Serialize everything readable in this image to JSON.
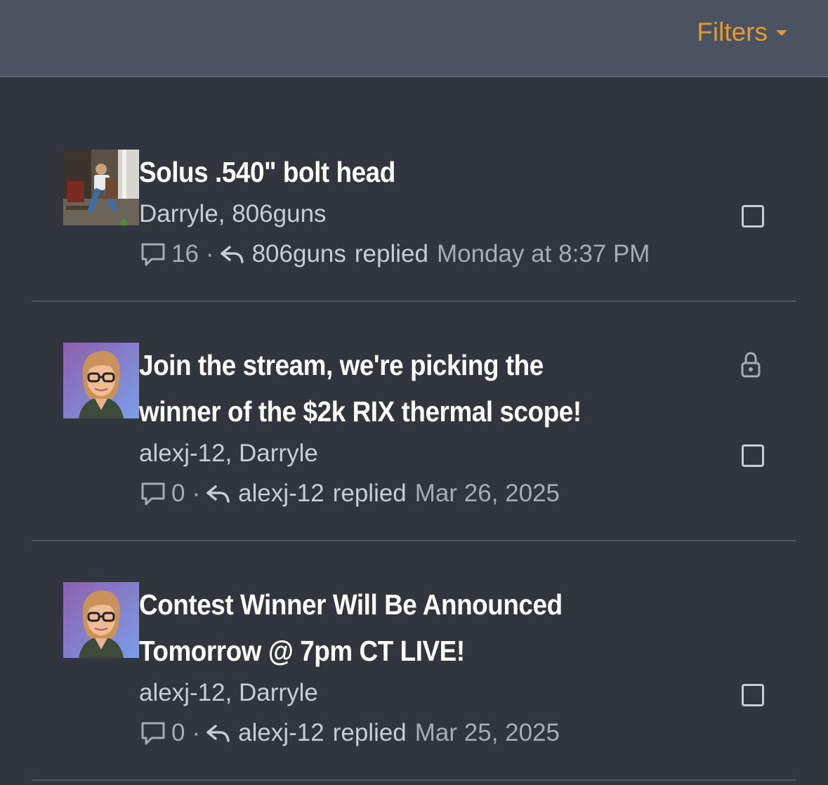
{
  "header": {
    "filters_label": "Filters"
  },
  "threads": [
    {
      "title_line1": "Solus .540\" bolt head",
      "title_line2": "",
      "starters": "Darryle, 806guns",
      "reply_count": "16",
      "last_poster": "806guns",
      "replied_label": "replied",
      "last_date": "Monday at 8:37 PM",
      "locked": false,
      "avatar": "photo-avatar"
    },
    {
      "title_line1": "Join the stream, we're picking the",
      "title_line2": "winner of the $2k RIX thermal scope!",
      "starters": "alexj-12, Darryle",
      "reply_count": "0",
      "last_poster": "alexj-12",
      "replied_label": "replied",
      "last_date": "Mar 26, 2025",
      "locked": true,
      "avatar": "cartoon-avatar"
    },
    {
      "title_line1": "Contest Winner Will Be Announced",
      "title_line2": "Tomorrow @ 7pm CT LIVE!",
      "starters": "alexj-12, Darryle",
      "reply_count": "0",
      "last_poster": "alexj-12",
      "replied_label": "replied",
      "last_date": "Mar 25, 2025",
      "locked": false,
      "avatar": "cartoon-avatar"
    }
  ],
  "colors": {
    "background": "#30353e",
    "header_bg": "#4a535f",
    "accent": "#e49a34",
    "title": "#ffffff",
    "muted": "#a6adb7"
  }
}
